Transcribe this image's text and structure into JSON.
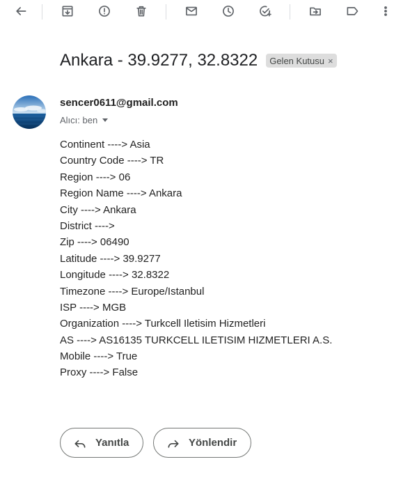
{
  "toolbar": {
    "icons": [
      "back-arrow-icon",
      "archive-icon",
      "report-spam-icon",
      "delete-icon",
      "mark-unread-icon",
      "snooze-icon",
      "add-task-icon",
      "move-to-icon",
      "labels-icon",
      "more-vert-icon"
    ]
  },
  "email": {
    "subject": "Ankara - 39.9277, 32.8322",
    "label": "Gelen Kutusu",
    "label_remove": "×",
    "sender": "sencer0611@gmail.com",
    "recipient": "Alıcı: ben",
    "body": [
      "Continent ----> Asia",
      "Country Code ----> TR",
      "Region ----> 06",
      "Region Name ----> Ankara",
      "City ----> Ankara",
      "District ---->",
      "Zip ----> 06490",
      "Latitude ----> 39.9277",
      "Longitude ----> 32.8322",
      "Timezone ----> Europe/Istanbul",
      "ISP ----> MGB",
      "Organization ----> Turkcell Iletisim Hizmetleri",
      "AS ----> AS16135 TURKCELL ILETISIM HIZMETLERI A.S.",
      "Mobile ----> True",
      "Proxy ----> False"
    ]
  },
  "actions": {
    "reply": "Yanıtla",
    "forward": "Yönlendir"
  },
  "colors": {
    "icon": "#5f6368",
    "chip_bg": "#dddddd",
    "text": "#202124",
    "button_border": "#747775"
  }
}
